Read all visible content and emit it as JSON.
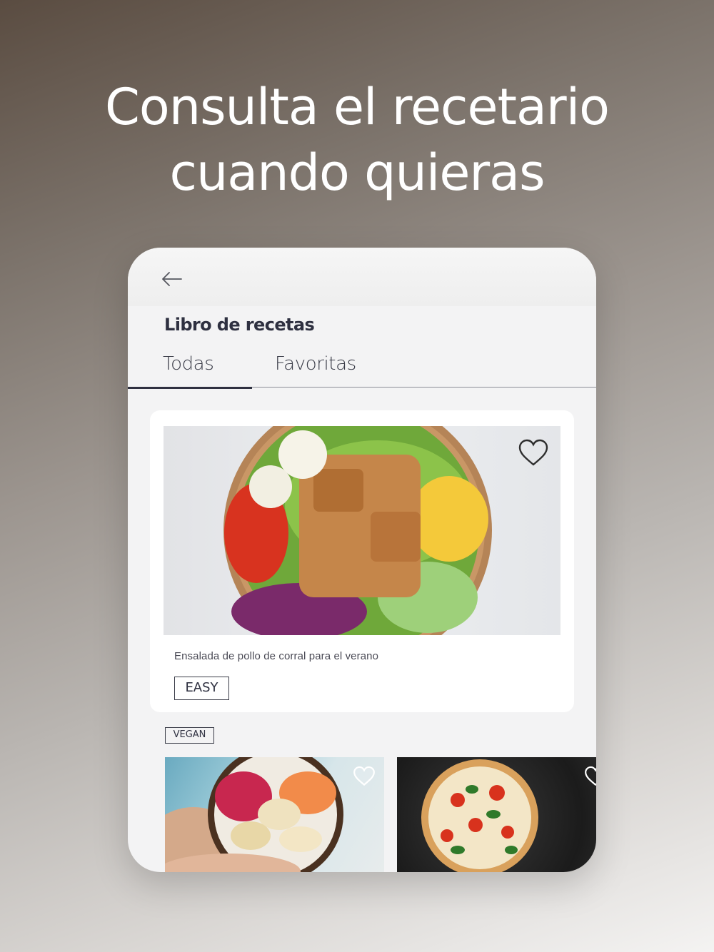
{
  "headline": {
    "line1": "Consulta el recetario",
    "line2": "cuando quieras"
  },
  "app": {
    "title": "Libro de recetas",
    "back_icon": "arrow-left-icon",
    "tabs": [
      {
        "label": "Todas",
        "selected": true
      },
      {
        "label": "Favoritas",
        "selected": false
      }
    ]
  },
  "featured": {
    "title": "Ensalada de pollo de corral para el verano",
    "tag": "EASY",
    "image": "salad-bowl-photo",
    "favorite_icon": "heart-outline-icon"
  },
  "section": {
    "tag": "VEGAN"
  },
  "thumbnails": [
    {
      "image": "fruit-smoothie-bowl-photo",
      "favorite_icon": "heart-outline-icon"
    },
    {
      "image": "pizza-photo",
      "favorite_icon": "heart-outline-icon"
    }
  ],
  "colors": {
    "accent": "#2e3040",
    "surface": "#f3f3f4"
  }
}
